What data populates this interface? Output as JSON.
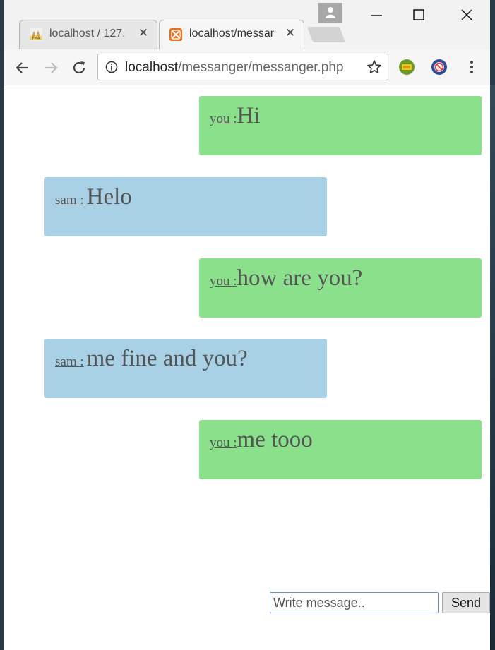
{
  "browser": {
    "tabs": [
      {
        "title": "localhost / 127.",
        "active": false,
        "favicon": "phpmyadmin-icon"
      },
      {
        "title": "localhost/messanger",
        "active": true,
        "favicon": "xampp-icon"
      }
    ],
    "url": {
      "host": "localhost",
      "path": "/messanger/messanger.php"
    },
    "colors": {
      "tabstrip": "#f2f2f2",
      "toolbar": "#f6f6f6"
    }
  },
  "chat": {
    "messages": [
      {
        "sender": "you :",
        "text": "Hi",
        "side": "right",
        "color": "#8be08c"
      },
      {
        "sender": "sam :",
        "text": "Helo",
        "side": "left",
        "color": "#a8d1e6"
      },
      {
        "sender": "you :",
        "text": "how are you?",
        "side": "right",
        "color": "#8be08c"
      },
      {
        "sender": "sam :",
        "text": "me fine and you?",
        "side": "left",
        "color": "#a8d1e6"
      },
      {
        "sender": "you :",
        "text": "me tooo",
        "side": "right",
        "color": "#8be08c"
      }
    ]
  },
  "composer": {
    "placeholder": "Write message..",
    "value": "",
    "send_label": "Send"
  }
}
